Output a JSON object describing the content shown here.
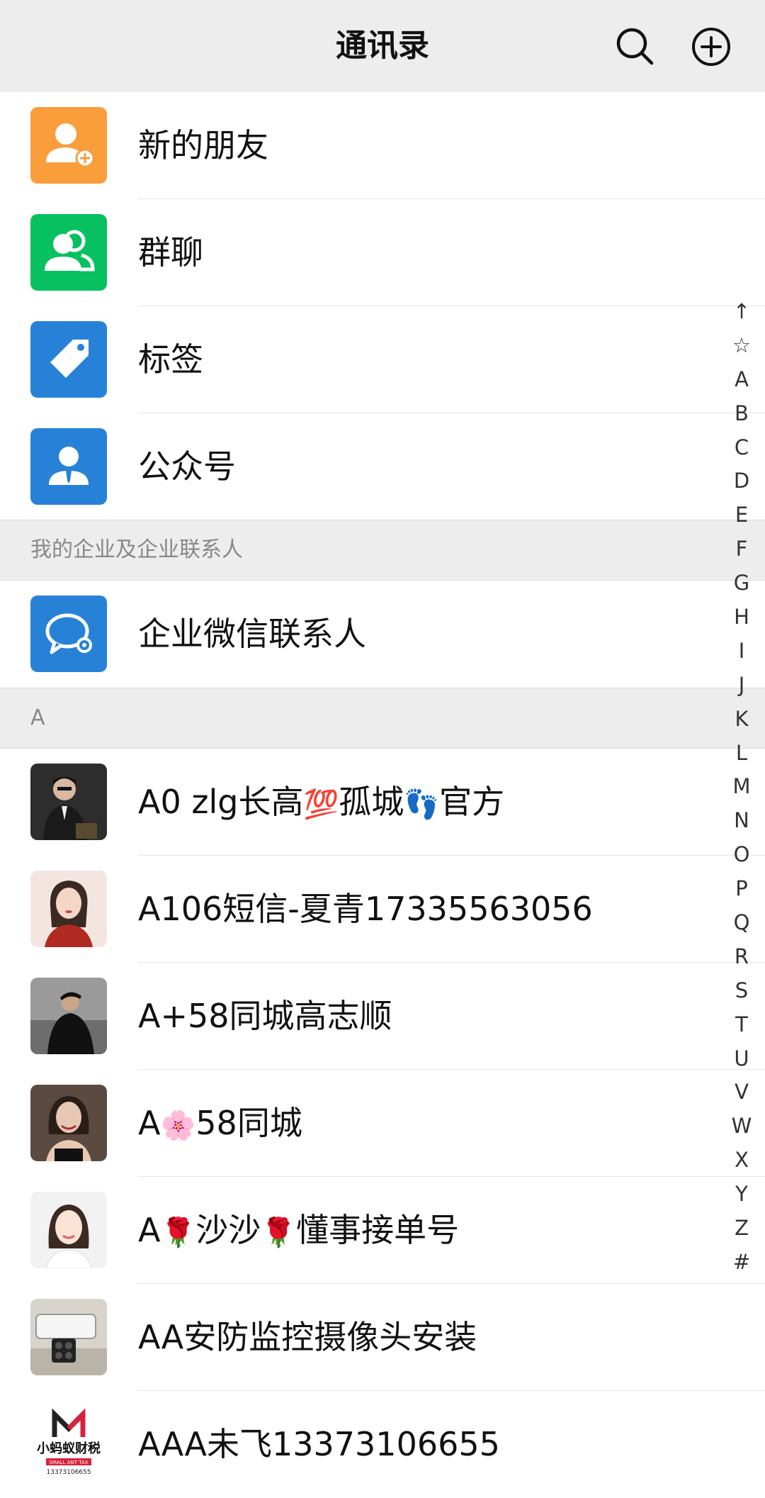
{
  "header": {
    "title": "通讯录",
    "search_icon": "search-icon",
    "add_icon": "plus-circle-icon"
  },
  "menu": [
    {
      "label": "新的朋友",
      "icon": "add-friend-icon",
      "color": "#fa9d3b"
    },
    {
      "label": "群聊",
      "icon": "group-chat-icon",
      "color": "#07c160"
    },
    {
      "label": "标签",
      "icon": "tag-icon",
      "color": "#2782d7"
    },
    {
      "label": "公众号",
      "icon": "official-account-icon",
      "color": "#2782d7"
    }
  ],
  "enterprise_section": "我的企业及企业联系人",
  "enterprise_item": {
    "label": "企业微信联系人",
    "icon": "wecom-contacts-icon",
    "color": "#2782d7"
  },
  "letter_section": "A",
  "contacts": [
    {
      "prefix": "A0 zlg长高",
      "emoji1": "💯",
      "middle": "孤城",
      "emoji2": "👣",
      "suffix": "官方"
    },
    {
      "prefix": "A106短信-夏青17335563056"
    },
    {
      "prefix": "A+58同城高志顺"
    },
    {
      "prefix": "A",
      "emoji1": "🌸",
      "middle": "58同城"
    },
    {
      "prefix": "A",
      "emoji1": "🌹",
      "middle": "沙沙",
      "emoji2": "🌹",
      "suffix": "懂事接单号"
    },
    {
      "prefix": "AA安防监控摄像头安装"
    },
    {
      "prefix": "AAA未飞13373106655"
    }
  ],
  "logo_text": {
    "main": "小蚂蚁财税",
    "sub": "SMALL ANT TAX",
    "phone": "13373106655"
  },
  "index": [
    "↑",
    "☆",
    "A",
    "B",
    "C",
    "D",
    "E",
    "F",
    "G",
    "H",
    "I",
    "J",
    "K",
    "L",
    "M",
    "N",
    "O",
    "P",
    "Q",
    "R",
    "S",
    "T",
    "U",
    "V",
    "W",
    "X",
    "Y",
    "Z",
    "#"
  ]
}
